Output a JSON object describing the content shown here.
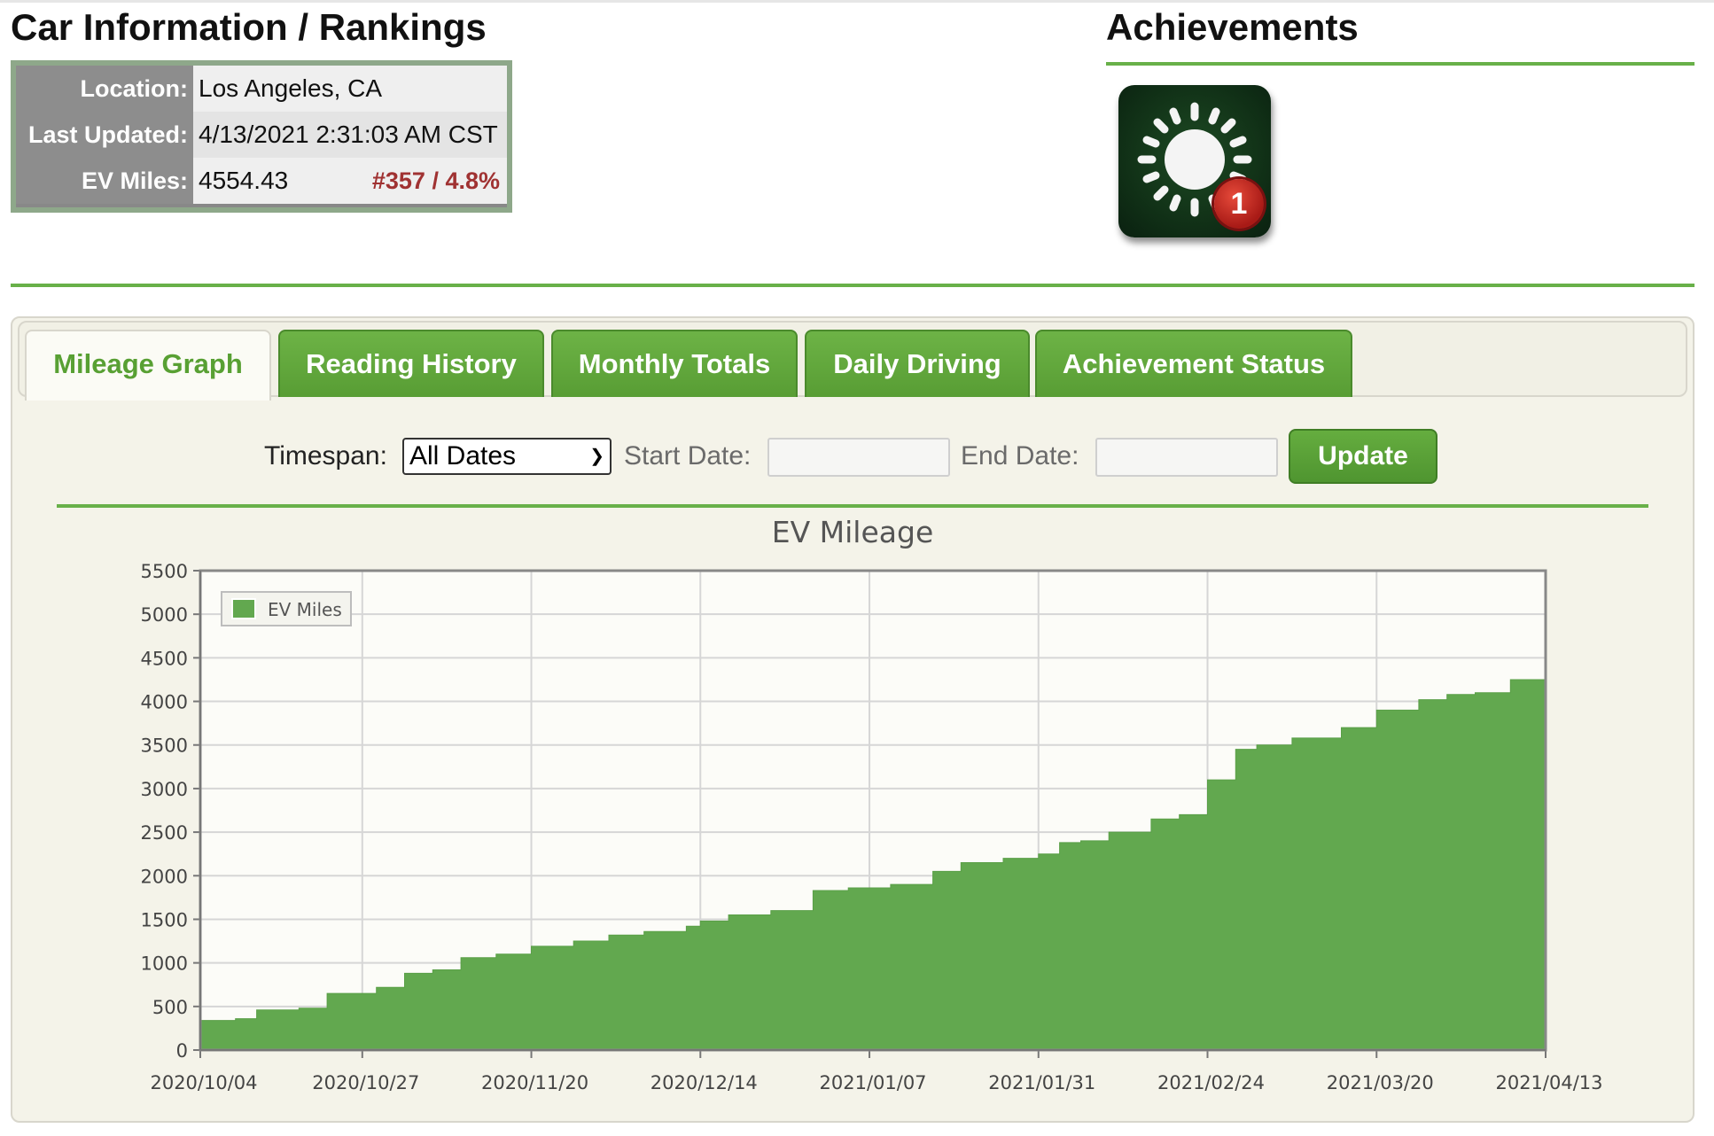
{
  "car_info": {
    "title": "Car Information / Rankings",
    "rows": [
      {
        "label": "Location:",
        "value": "Los Angeles, CA",
        "rank": ""
      },
      {
        "label": "Last Updated:",
        "value": "4/13/2021 2:31:03 AM CST",
        "rank": ""
      },
      {
        "label": "EV Miles:",
        "value": "4554.43",
        "rank": "#357 / 4.8%"
      }
    ]
  },
  "achievements": {
    "title": "Achievements",
    "badge": {
      "icon": "sun-icon",
      "count": "1"
    }
  },
  "tabs": [
    {
      "label": "Mileage Graph",
      "active": true
    },
    {
      "label": "Reading History",
      "active": false
    },
    {
      "label": "Monthly Totals",
      "active": false
    },
    {
      "label": "Daily Driving",
      "active": false
    },
    {
      "label": "Achievement Status",
      "active": false
    }
  ],
  "controls": {
    "timespan_label": "Timespan:",
    "timespan_value": "All Dates",
    "start_label": "Start Date:",
    "start_value": "",
    "end_label": "End Date:",
    "end_value": "",
    "update_label": "Update"
  },
  "colors": {
    "accent": "#68b049",
    "series": "#62a84f",
    "rank": "#a03232"
  },
  "chart_data": {
    "type": "area",
    "title": "EV Mileage",
    "xlabel": "",
    "ylabel": "",
    "ylim": [
      0,
      5500
    ],
    "yticks": [
      0,
      500,
      1000,
      1500,
      2000,
      2500,
      3000,
      3500,
      4000,
      4500,
      5000,
      5500
    ],
    "xlim": [
      "2020/10/04",
      "2021/04/13"
    ],
    "xticks": [
      "2020/10/04",
      "2020/10/27",
      "2020/11/20",
      "2020/12/14",
      "2021/01/07",
      "2021/01/31",
      "2021/02/24",
      "2021/03/20",
      "2021/04/13"
    ],
    "grid": true,
    "legend": {
      "position": "top-left",
      "entries": [
        "EV Miles"
      ]
    },
    "series": [
      {
        "name": "EV Miles",
        "x": [
          "2020/10/04",
          "2020/10/09",
          "2020/10/12",
          "2020/10/18",
          "2020/10/22",
          "2020/10/29",
          "2020/11/02",
          "2020/11/06",
          "2020/11/10",
          "2020/11/15",
          "2020/11/20",
          "2020/11/26",
          "2020/12/01",
          "2020/12/06",
          "2020/12/12",
          "2020/12/14",
          "2020/12/18",
          "2020/12/24",
          "2020/12/30",
          "2021/01/04",
          "2021/01/10",
          "2021/01/16",
          "2021/01/20",
          "2021/01/26",
          "2021/01/31",
          "2021/02/03",
          "2021/02/06",
          "2021/02/10",
          "2021/02/16",
          "2021/02/20",
          "2021/02/24",
          "2021/02/28",
          "2021/03/03",
          "2021/03/08",
          "2021/03/15",
          "2021/03/20",
          "2021/03/26",
          "2021/03/30",
          "2021/04/03",
          "2021/04/08",
          "2021/04/13"
        ],
        "y": [
          340,
          360,
          460,
          480,
          650,
          720,
          880,
          920,
          1060,
          1100,
          1190,
          1250,
          1320,
          1360,
          1420,
          1480,
          1550,
          1600,
          1830,
          1860,
          1900,
          2050,
          2150,
          2200,
          2250,
          2380,
          2400,
          2500,
          2650,
          2700,
          3100,
          3450,
          3500,
          3580,
          3700,
          3900,
          4020,
          4080,
          4100,
          4250,
          4554.43
        ]
      }
    ]
  }
}
